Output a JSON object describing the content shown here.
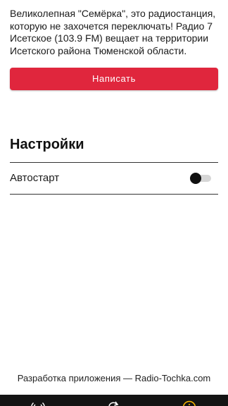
{
  "about": {
    "description": "Великолепная \"Семёрка\", это радиостанция, которую не захочется переключать! Радио 7 Исетское (103.9 FM) вещает на территории Исетского района Тюменской области.",
    "write_button_label": "Написать"
  },
  "settings": {
    "title": "Настройки",
    "autostart_label": "Автостарт",
    "autostart_enabled": false
  },
  "footer": {
    "credit": "Разработка приложения — Radio-Tochka.com"
  },
  "bottom_nav": {
    "items": [
      {
        "icon": "radio-broadcast-icon",
        "active": false
      },
      {
        "icon": "refresh-icon",
        "active": false
      },
      {
        "icon": "info-icon",
        "active": true
      }
    ],
    "active_color": "#f5b301",
    "inactive_color": "#ffffff"
  },
  "colors": {
    "accent": "#e0263d",
    "nav_background": "#141414"
  }
}
